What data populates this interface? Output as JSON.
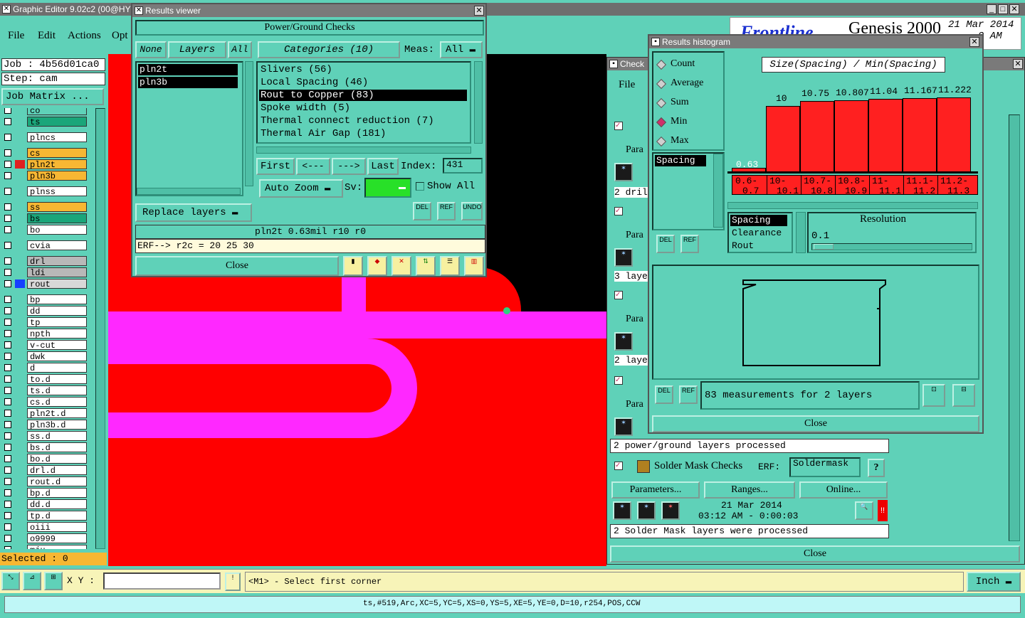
{
  "main_window": {
    "title": "Graphic Editor 9.02c2 (00@HY",
    "menu": [
      "File",
      "Edit",
      "Actions",
      "Opt"
    ]
  },
  "job_panel": {
    "job": "Job : 4b56d01ca0",
    "step": "Step: cam",
    "job_matrix": "Job Matrix ...",
    "selected": "Selected : 0",
    "layers": [
      "co",
      "ts",
      "plncs",
      "cs",
      "pln2t",
      "pln3b",
      "plnss",
      "ss",
      "bs",
      "bo",
      "cvia",
      "drl",
      "ldi",
      "rout",
      "bp",
      "dd",
      "tp",
      "npth",
      "v-cut",
      "dwk",
      "d",
      "to.d",
      "ts.d",
      "cs.d",
      "pln2t.d",
      "pln3b.d",
      "ss.d",
      "bs.d",
      "bo.d",
      "drl.d",
      "rout.d",
      "bp.d",
      "dd.d",
      "tp.d",
      "oiii",
      "o9999",
      "mju"
    ]
  },
  "status_bar": {
    "xy_label": "X Y :",
    "xy_value": "",
    "hint": "<M1> - Select first corner",
    "units": "Inch",
    "feature_info": "ts,#519,Arc,XC=5,YC=5,XS=0,YS=5,XE=5,YE=0,D=10,r254,POS,CCW"
  },
  "results_viewer": {
    "title": "Results viewer",
    "header": "Power/Ground Checks",
    "tabs": [
      "None",
      "Layers",
      "All"
    ],
    "categories_label": "Categories (10)",
    "meas_label": "Meas:",
    "meas_value": "All",
    "layers": [
      "pln2t",
      "pln3b"
    ],
    "categories": [
      "Slivers (56)",
      "Local Spacing (46)",
      "Rout to Copper (83)",
      "Spoke width (5)",
      "Thermal connect reduction (7)",
      "Thermal Air Gap (181)"
    ],
    "nav": [
      "First",
      "<---",
      "--->",
      "Last"
    ],
    "index_label": "Index:",
    "index_value": "431",
    "auto_zoom": "Auto Zoom",
    "sv_label": "Sv:",
    "show_all": "Show All",
    "replace_layers": "Replace layers",
    "del": "DEL",
    "ref": "REF",
    "undo": "UNDO",
    "info_line": "pln2t 0.63mil r10 r0",
    "erf_line": "ERF--> r2c = 20 25 30",
    "close": "Close"
  },
  "checklist": {
    "title": "Check",
    "file_menu": "File",
    "rows": [
      "Para",
      "2 dril",
      "Para",
      "3 laye",
      "Para",
      "2 laye",
      "Para"
    ],
    "pg_processed": "2 power/ground layers processed",
    "solder_title": "Solder Mask Checks",
    "erf_label": "ERF:",
    "erf_value": "Soldermask",
    "help": "?",
    "buttons": [
      "Parameters...",
      "Ranges...",
      "Online..."
    ],
    "date": "21 Mar 2014",
    "time": "03:12 AM - 0:00:03",
    "solder_processed": "2 Solder Mask layers were processed",
    "close": "Close"
  },
  "genesis": {
    "brand": "Genesis 2000",
    "date": "21 Mar 2014",
    "time": "9 AM"
  },
  "histogram": {
    "title": "Results histogram",
    "modes": [
      "Count",
      "Average",
      "Sum",
      "Min",
      "Max"
    ],
    "selected_mode": "Min",
    "metric": "Size(Spacing) / Min(Spacing)",
    "list": [
      "Spacing"
    ],
    "list2": [
      "Spacing",
      "Clearance",
      "Rout"
    ],
    "resolution_label": "Resolution",
    "resolution_value": "0.1",
    "summary": "83 measurements for 2 layers",
    "del": "DEL",
    "ref": "REF",
    "close": "Close"
  },
  "chart_data": {
    "type": "bar",
    "categories": [
      "0.6-\n0.7",
      "10-\n10.1",
      "10.7-\n10.8",
      "10.8-\n10.9",
      "11-\n11.1",
      "11.1-\n11.2",
      "11.2-\n11.3"
    ],
    "values": [
      0.63,
      10,
      10.75,
      10.807,
      11.04,
      11.167,
      11.222
    ],
    "value_labels": [
      "0.63",
      "10",
      "10.75",
      "10.807",
      "11.04",
      "11.167",
      "11.222"
    ],
    "bin_labels": [
      "0.6-",
      "10-",
      "10.7-",
      "10.8-",
      "11-",
      "11.1-",
      "11.2-"
    ],
    "bin_labels2": [
      "0.7",
      "10.1",
      "10.8",
      "10.9",
      "11.1",
      "11.2",
      "11.3"
    ],
    "ylim": [
      0,
      12
    ],
    "colors": {
      "bar": "#ff2020"
    }
  }
}
